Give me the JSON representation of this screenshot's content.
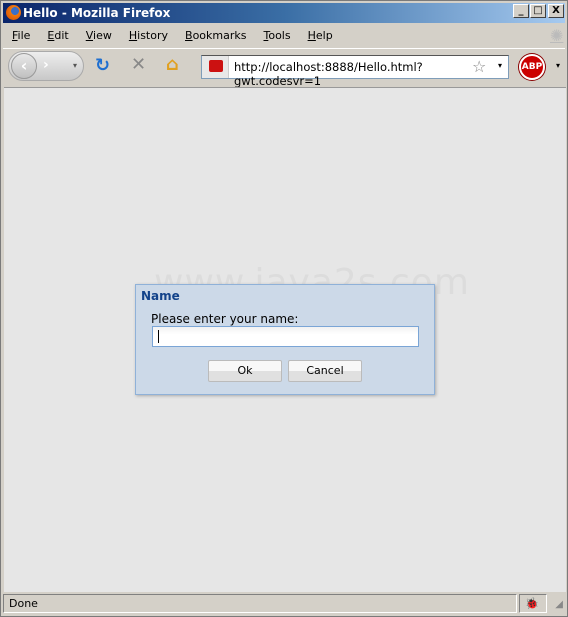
{
  "window": {
    "title": "Hello - Mozilla Firefox",
    "controls": [
      "_",
      "□",
      "X"
    ]
  },
  "menu": [
    "File",
    "Edit",
    "View",
    "History",
    "Bookmarks",
    "Tools",
    "Help"
  ],
  "toolbar": {
    "url": "http://localhost:8888/Hello.html?gwt.codesvr=1",
    "adblock_label": "ABP"
  },
  "watermark": "www.java2s.com",
  "dialog": {
    "title": "Name",
    "label": "Please enter your name:",
    "value": "",
    "ok": "Ok",
    "cancel": "Cancel"
  },
  "status": {
    "text": "Done"
  }
}
